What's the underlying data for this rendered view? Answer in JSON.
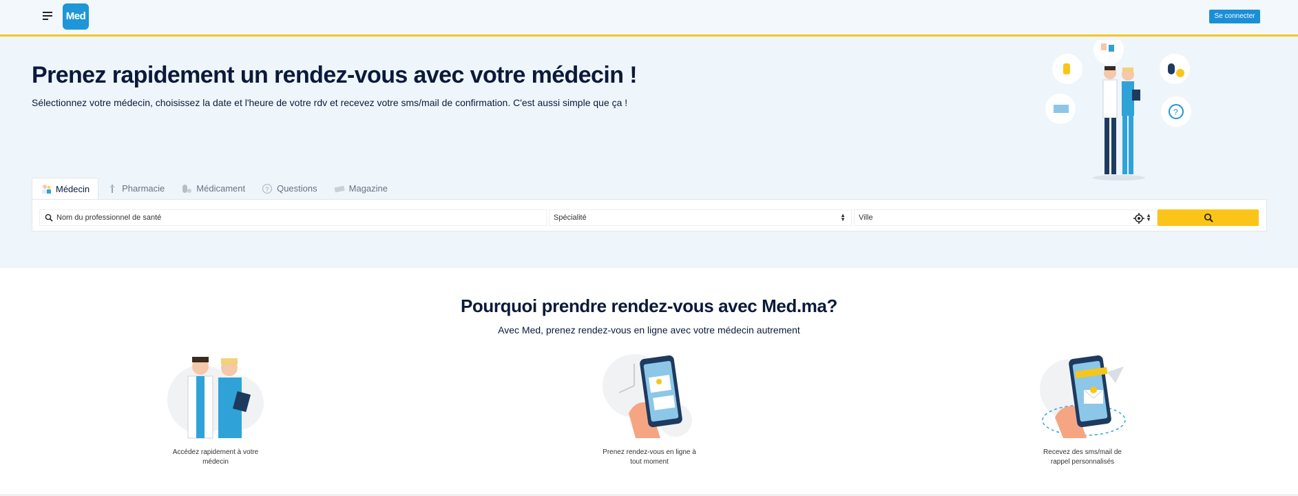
{
  "header": {
    "logo_text": "Med",
    "login_label": "Se connecter",
    "accent_color": "#f7c61a",
    "brand_color": "#1e96d8"
  },
  "hero": {
    "title": "Prenez rapidement un rendez-vous avec votre médecin !",
    "subtitle": "Sélectionnez votre médecin, choisissez la date et l'heure de votre rdv et recevez votre sms/mail de confirmation. C'est aussi simple que ça !"
  },
  "tabs": [
    {
      "label": "Médecin",
      "icon": "doctor-icon",
      "active": true
    },
    {
      "label": "Pharmacie",
      "icon": "pharmacy-icon",
      "active": false
    },
    {
      "label": "Médicament",
      "icon": "medicine-icon",
      "active": false
    },
    {
      "label": "Questions",
      "icon": "question-icon",
      "active": false
    },
    {
      "label": "Magazine",
      "icon": "magazine-icon",
      "active": false
    }
  ],
  "search": {
    "name_placeholder": "Nom du professionnel de santé",
    "specialty_value": "Spécialité",
    "city_value": "Ville"
  },
  "why": {
    "title": "Pourquoi prendre rendez-vous avec Med.ma?",
    "subtitle": "Avec Med, prenez rendez-vous en ligne avec votre médecin autrement",
    "features": [
      {
        "caption": "Accédez rapidement à votre médecin",
        "icon": "doctors-illustration"
      },
      {
        "caption": "Prenez rendez-vous en ligne à tout moment",
        "icon": "phone-calendar-illustration"
      },
      {
        "caption": "Recevez des sms/mail de rappel personnalisés",
        "icon": "phone-mail-illustration"
      }
    ]
  }
}
